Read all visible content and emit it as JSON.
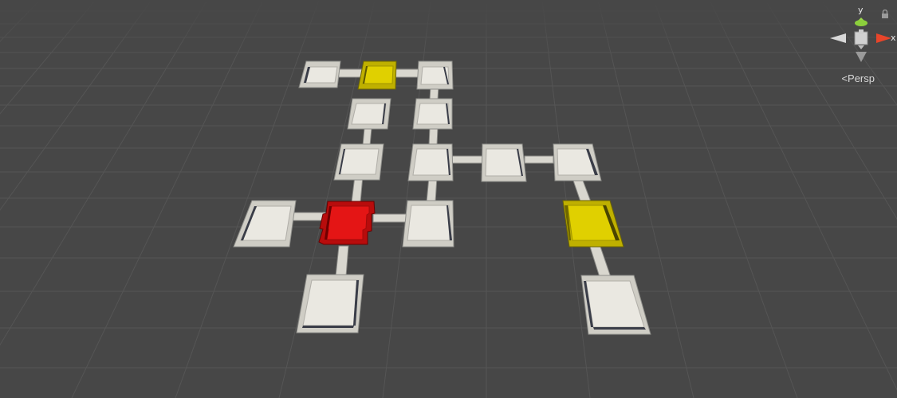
{
  "scene_view": {
    "background_color": "#474747",
    "grid_color": "#5a5a5a",
    "room_color": "#e6e4dc",
    "highlight_colors": {
      "selected_red": "#e01010",
      "selected_yellow": "#d9c800"
    }
  },
  "gizmo": {
    "y_label": "y",
    "x_label": "x",
    "projection_label": "Persp",
    "icons": [
      "orientation-gizmo-icon",
      "lock-icon"
    ]
  }
}
